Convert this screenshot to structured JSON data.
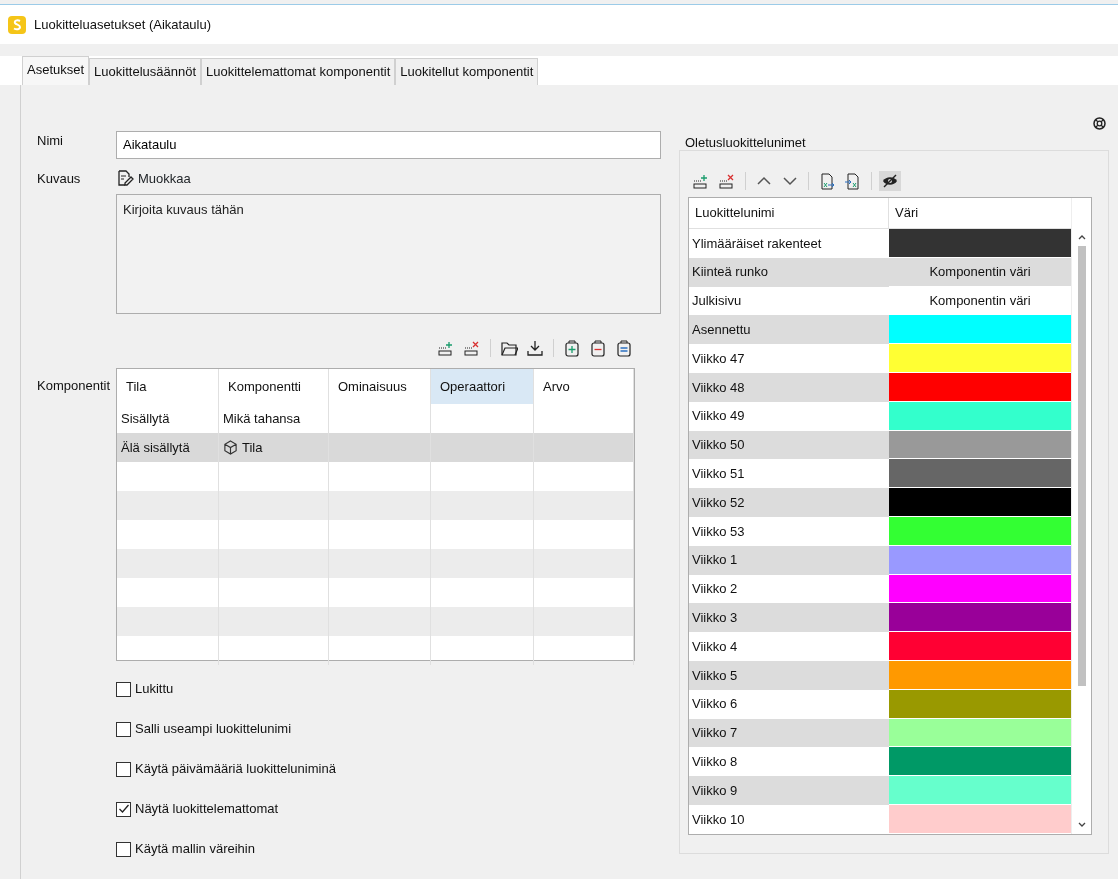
{
  "window": {
    "title": "Luokitteluasetukset (Aikataulu)"
  },
  "tabs": [
    {
      "label": "Asetukset",
      "selected": true
    },
    {
      "label": "Luokittelusäännöt",
      "selected": false
    },
    {
      "label": "Luokittelemattomat komponentit",
      "selected": false
    },
    {
      "label": "Luokitellut komponentit",
      "selected": false
    }
  ],
  "form": {
    "name_label": "Nimi",
    "name_value": "Aikataulu",
    "description_label": "Kuvaus",
    "edit_link": "Muokkaa",
    "description_placeholder": "Kirjoita kuvaus tähän",
    "components_label": "Komponentit"
  },
  "components_table": {
    "columns": [
      {
        "label": "Tila",
        "selected": false
      },
      {
        "label": "Komponentti",
        "selected": false
      },
      {
        "label": "Ominaisuus",
        "selected": false
      },
      {
        "label": "Operaattori",
        "selected": true
      },
      {
        "label": "Arvo",
        "selected": false
      }
    ],
    "rows": [
      {
        "cells": [
          "Sisällytä",
          "Mikä tahansa"
        ],
        "component_icon": false,
        "selected": false
      },
      {
        "cells": [
          "Älä sisällytä",
          "Tila"
        ],
        "component_icon": true,
        "selected": true
      }
    ]
  },
  "checkboxes": [
    {
      "label": "Lukittu",
      "checked": false
    },
    {
      "label": "Salli useampi luokittelunimi",
      "checked": false
    },
    {
      "label": "Käytä päivämääriä luokitteluniminä",
      "checked": false
    },
    {
      "label": "Näytä luokittelemattomat",
      "checked": true
    },
    {
      "label": "Käytä mallin väreihin",
      "checked": false
    }
  ],
  "default_names": {
    "title": "Oletusluokittelunimet",
    "hide_toggle_on": true,
    "columns": [
      "Luokittelunimi",
      "Väri"
    ],
    "rows": [
      {
        "name": "Ylimääräiset rakenteet",
        "kind": "swatch",
        "color": "#333333"
      },
      {
        "name": "Kiinteä runko",
        "kind": "text",
        "value": "Komponentin väri"
      },
      {
        "name": "Julkisivu",
        "kind": "text",
        "value": "Komponentin väri"
      },
      {
        "name": "Asennettu",
        "kind": "swatch",
        "color": "#00ffff"
      },
      {
        "name": "Viikko 47",
        "kind": "swatch",
        "color": "#ffff33"
      },
      {
        "name": "Viikko 48",
        "kind": "swatch",
        "color": "#ff0000"
      },
      {
        "name": "Viikko 49",
        "kind": "swatch",
        "color": "#33ffcc"
      },
      {
        "name": "Viikko 50",
        "kind": "swatch",
        "color": "#999999"
      },
      {
        "name": "Viikko 51",
        "kind": "swatch",
        "color": "#666666"
      },
      {
        "name": "Viikko 52",
        "kind": "swatch",
        "color": "#000000"
      },
      {
        "name": "Viikko 53",
        "kind": "swatch",
        "color": "#33ff33"
      },
      {
        "name": "Viikko 1",
        "kind": "swatch",
        "color": "#9999ff"
      },
      {
        "name": "Viikko 2",
        "kind": "swatch",
        "color": "#ff00ff"
      },
      {
        "name": "Viikko 3",
        "kind": "swatch",
        "color": "#990099"
      },
      {
        "name": "Viikko 4",
        "kind": "swatch",
        "color": "#ff0033"
      },
      {
        "name": "Viikko 5",
        "kind": "swatch",
        "color": "#ff9900"
      },
      {
        "name": "Viikko 6",
        "kind": "swatch",
        "color": "#999900"
      },
      {
        "name": "Viikko 7",
        "kind": "swatch",
        "color": "#99ff99"
      },
      {
        "name": "Viikko 8",
        "kind": "swatch",
        "color": "#009966"
      },
      {
        "name": "Viikko 9",
        "kind": "swatch",
        "color": "#66ffcc"
      },
      {
        "name": "Viikko 10",
        "kind": "swatch",
        "color": "#ffcccc"
      }
    ]
  }
}
